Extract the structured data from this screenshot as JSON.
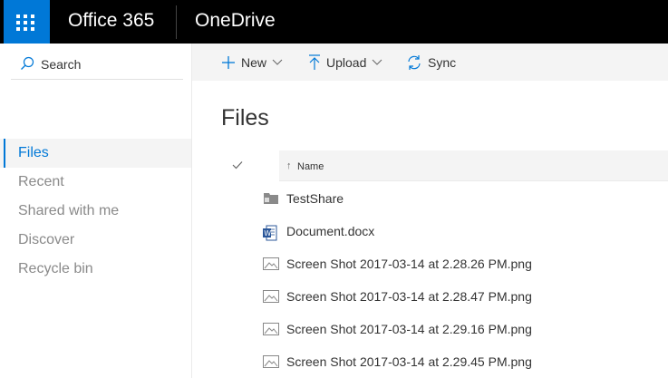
{
  "suitebar": {
    "brand": "Office 365",
    "app_name": "OneDrive",
    "waffle_icon": "app-launcher-icon",
    "colors": {
      "bar": "#000000",
      "waffle": "#0078d7"
    }
  },
  "leftnav": {
    "search_label": "Search",
    "items": [
      {
        "label": "Files",
        "selected": true
      },
      {
        "label": "Recent"
      },
      {
        "label": "Shared with me"
      },
      {
        "label": "Discover"
      },
      {
        "label": "Recycle bin"
      }
    ],
    "accent_color": "#0078d7"
  },
  "commandbar": {
    "new_label": "New",
    "upload_label": "Upload",
    "sync_label": "Sync"
  },
  "main": {
    "title": "Files",
    "columns": {
      "name": "Name"
    },
    "files": [
      {
        "name": "TestShare",
        "type": "folder-shared-icon"
      },
      {
        "name": "Document.docx",
        "type": "word-doc-icon"
      },
      {
        "name": "Screen Shot 2017-03-14 at 2.28.26 PM.png",
        "type": "image-file-icon"
      },
      {
        "name": "Screen Shot 2017-03-14 at 2.28.47 PM.png",
        "type": "image-file-icon"
      },
      {
        "name": "Screen Shot 2017-03-14 at 2.29.16 PM.png",
        "type": "image-file-icon"
      },
      {
        "name": "Screen Shot 2017-03-14 at 2.29.45 PM.png",
        "type": "image-file-icon"
      }
    ]
  }
}
